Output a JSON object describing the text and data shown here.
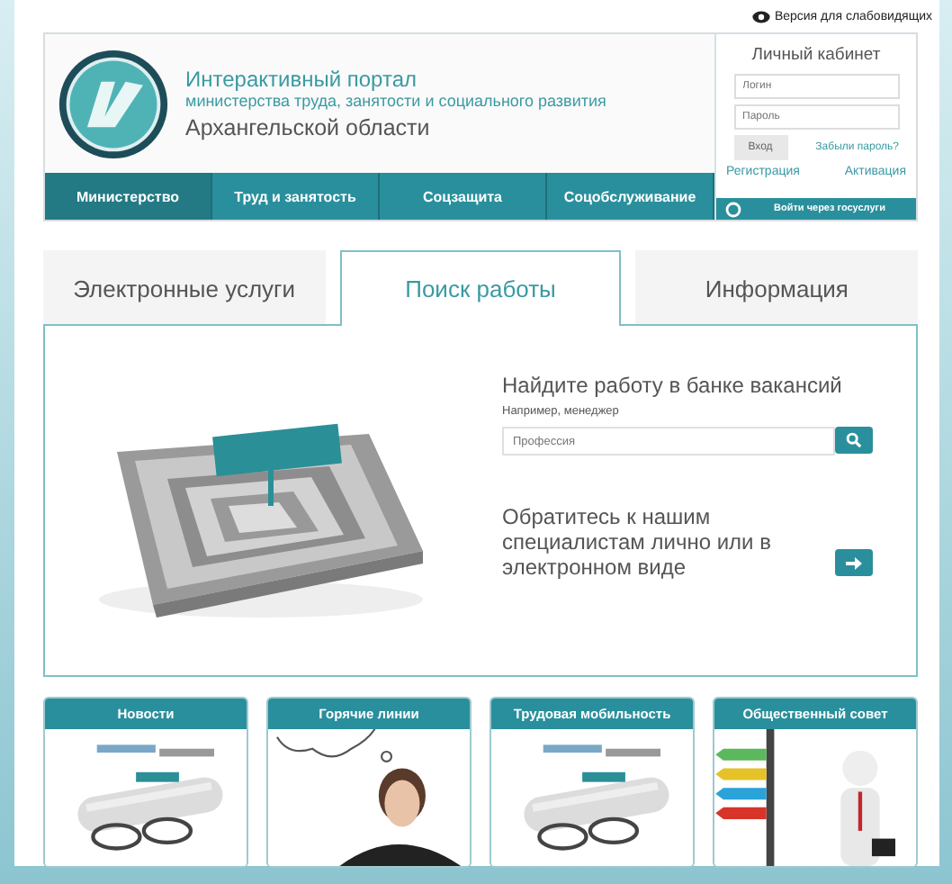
{
  "top_link": "Версия для слабовидящих",
  "header": {
    "title": "Интерактивный портал",
    "subtitle": "министерства труда, занятости и социального развития",
    "region": "Архангельской области"
  },
  "nav": [
    {
      "label": "Министерство",
      "selected": true
    },
    {
      "label": "Труд и занятость",
      "selected": false
    },
    {
      "label": "Соцзащита",
      "selected": false
    },
    {
      "label": "Соцобслуживание",
      "selected": false
    }
  ],
  "login": {
    "title": "Личный кабинет",
    "login_placeholder": "Логин",
    "password_placeholder": "Пароль",
    "submit": "Вход",
    "forgot": "Забыли пароль?",
    "register": "Регистрация",
    "activate": "Активация",
    "gosuslugi": "Войти через госуслуги"
  },
  "tabs": [
    {
      "label": "Электронные услуги",
      "selected": false
    },
    {
      "label": "Поиск работы",
      "selected": true
    },
    {
      "label": "Информация",
      "selected": false
    }
  ],
  "job_search": {
    "heading": "Найдите работу в банке вакансий",
    "hint": "Например, менеджер",
    "placeholder": "Профессия",
    "contact": "Обратитесь к нашим специалистам лично или в электронном виде"
  },
  "cards": [
    {
      "title": "Новости"
    },
    {
      "title": "Горячие линии"
    },
    {
      "title": "Трудовая мобильность"
    },
    {
      "title": "Общественный совет"
    }
  ]
}
